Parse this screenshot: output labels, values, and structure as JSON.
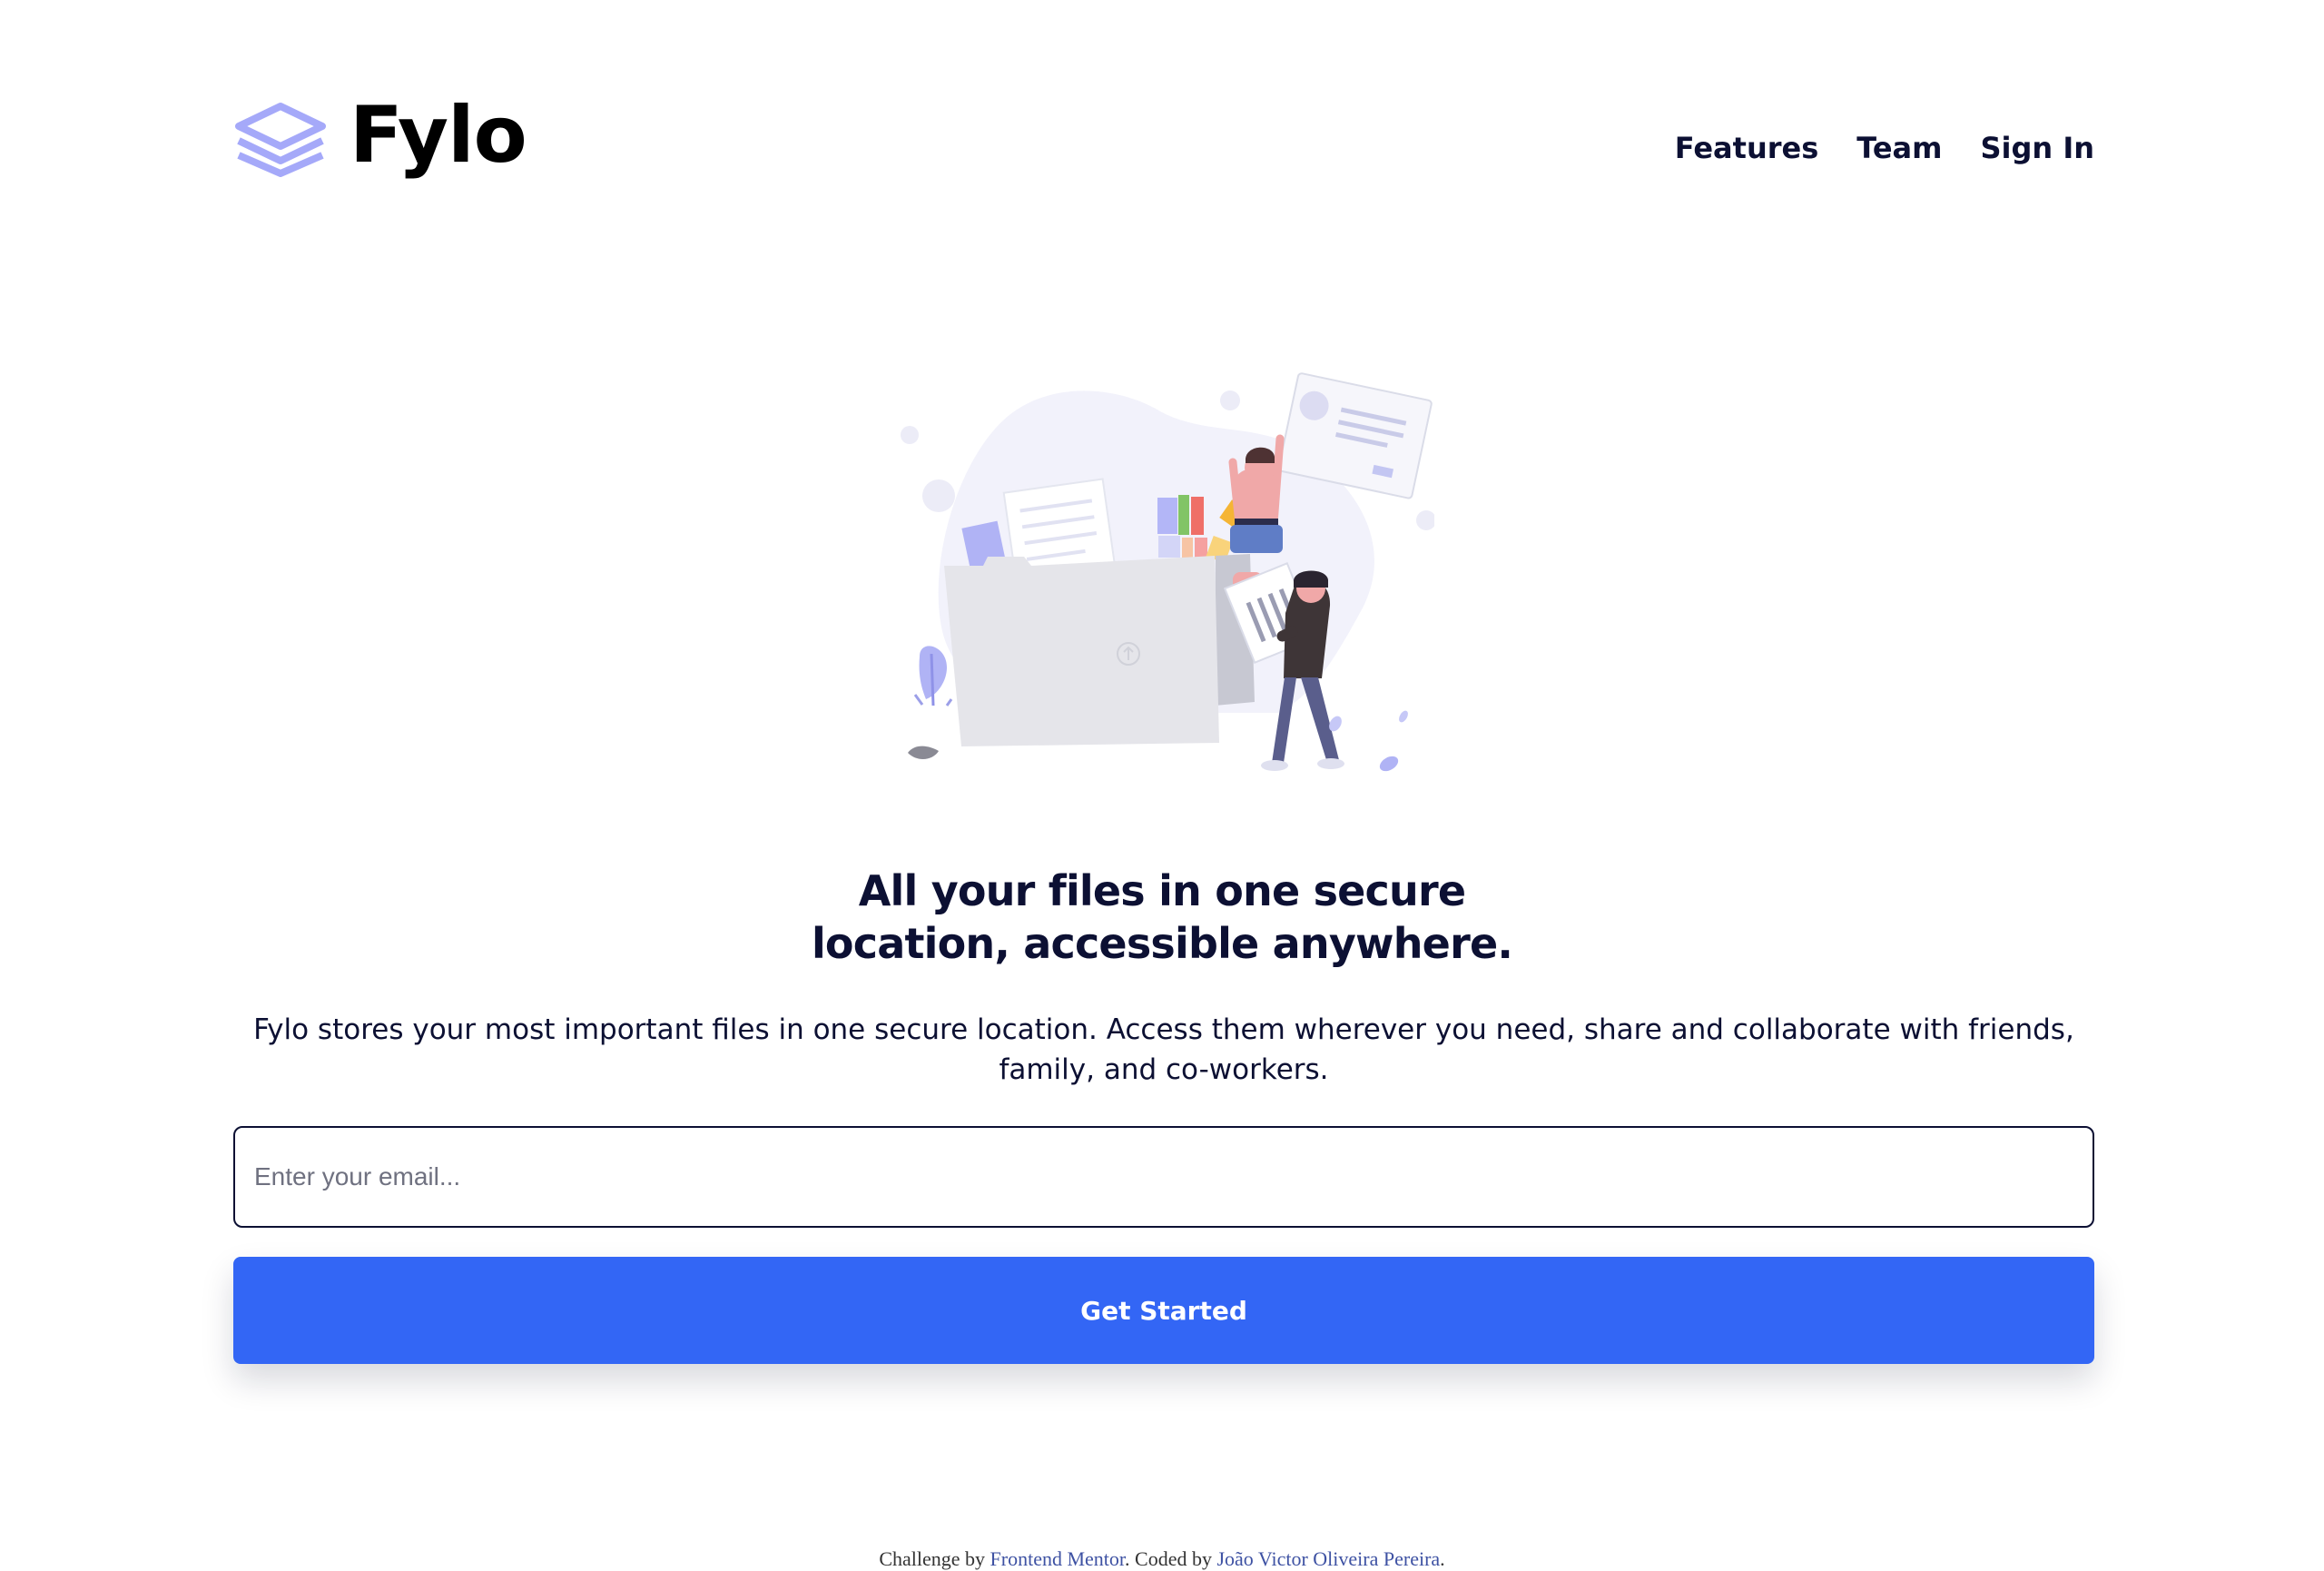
{
  "brand": {
    "name": "Fylo",
    "logo_icon": "layered-stack-icon",
    "logo_color": "#a5a9f9"
  },
  "nav": {
    "items": [
      {
        "label": "Features"
      },
      {
        "label": "Team"
      },
      {
        "label": "Sign In"
      }
    ]
  },
  "hero": {
    "illustration": "people-organizing-files-illustration",
    "headline_line1": "All your files in one secure",
    "headline_line2": "location, accessible anywhere.",
    "description": "Fylo stores your most important files in one secure location. Access them wherever you need, share and collaborate with friends, family, and co-workers."
  },
  "signup": {
    "email_placeholder": "Enter your email...",
    "email_value": "",
    "button_label": "Get Started"
  },
  "footer": {
    "challenge_prefix": "Challenge by",
    "challenge_link": "Frontend Mentor",
    "coded_prefix": ". Coded by",
    "author_link": "João Victor Oliveira Pereira",
    "suffix": "."
  },
  "colors": {
    "text": "#0c1033",
    "accent": "#3366f5",
    "link": "#3e52a3"
  }
}
